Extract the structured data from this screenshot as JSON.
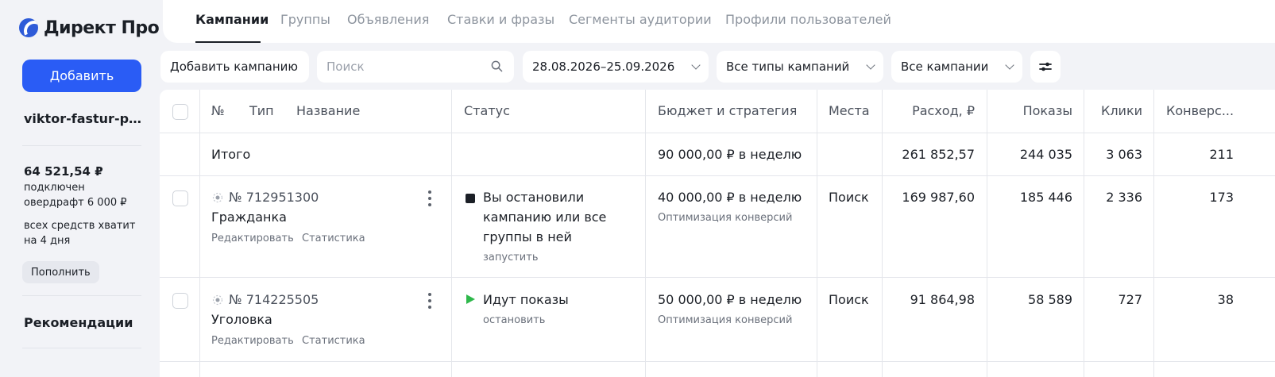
{
  "sidebar": {
    "logo": "Директ Про",
    "add_button": "Добавить",
    "account": "viktor-fastur-pr...",
    "balance": "64 521,54 ₽",
    "overdraft_note": "подключен овердрафт 6 000 ₽",
    "funds_note": "всех средств хватит на 4 дня",
    "refill_button": "Пополнить",
    "recommendations": "Рекомендации"
  },
  "tabs": [
    {
      "label": "Кампании",
      "active": true
    },
    {
      "label": "Группы",
      "active": false
    },
    {
      "label": "Объявления",
      "active": false
    },
    {
      "label": "Ставки и фразы",
      "active": false
    },
    {
      "label": "Сегменты аудитории",
      "active": false
    },
    {
      "label": "Профили пользователей",
      "active": false
    }
  ],
  "toolbar": {
    "add_campaign": "Добавить кампанию",
    "search_placeholder": "Поиск",
    "date_range": "28.08.2026–25.09.2026",
    "campaign_types": "Все типы кампаний",
    "campaigns_filter": "Все кампании"
  },
  "table": {
    "headers": {
      "num": "№",
      "type": "Тип",
      "name": "Название",
      "status": "Статус",
      "budget": "Бюджет и стратегия",
      "places": "Места",
      "spend": "Расход, ₽",
      "impressions": "Показы",
      "clicks": "Клики",
      "conversions": "Конверс..."
    },
    "total": {
      "label": "Итого",
      "budget": "90 000,00 ₽ в неделю",
      "spend": "261 852,57",
      "impressions": "244 035",
      "clicks": "3 063",
      "conversions": "211"
    },
    "rows": [
      {
        "id": "№ 712951300",
        "name": "Гражданка",
        "edit_link": "Редактировать",
        "stats_link": "Статистика",
        "status": "Вы остановили кампанию или все группы в ней",
        "status_action": "запустить",
        "budget": "40 000,00 ₽ в неделю",
        "strategy": "Оптимизация конверсий",
        "places": "Поиск",
        "spend": "169 987,60",
        "impressions": "185 446",
        "clicks": "2 336",
        "conversions": "173"
      },
      {
        "id": "№ 714225505",
        "name": "Уголовка",
        "edit_link": "Редактировать",
        "stats_link": "Статистика",
        "status": "Идут показы",
        "status_action": "остановить",
        "budget": "50 000,00 ₽ в неделю",
        "strategy": "Оптимизация конверсий",
        "places": "Поиск",
        "spend": "91 864,98",
        "impressions": "58 589",
        "clicks": "727",
        "conversions": "38"
      }
    ]
  },
  "colors": {
    "accent": "#2a5cf5",
    "running": "#2eb84b",
    "stopped": "#1b1f26"
  }
}
